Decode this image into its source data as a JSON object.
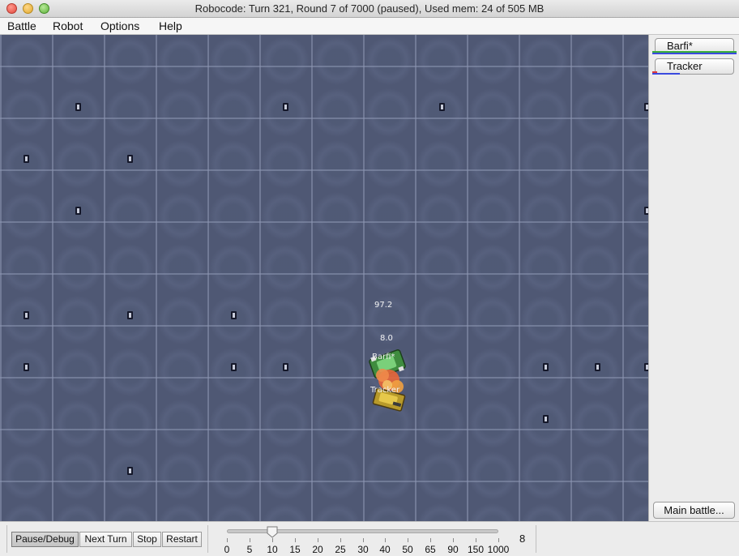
{
  "window": {
    "title": "Robocode: Turn 321, Round 7 of 7000 (paused), Used mem: 24 of 505 MB"
  },
  "menu": {
    "items": [
      "Battle",
      "Robot",
      "Options",
      "Help"
    ]
  },
  "battlefield": {
    "robots": [
      {
        "name": "Barfi*",
        "energy": "97.2",
        "bullet_power": "8.0"
      },
      {
        "name": "Tracker"
      }
    ]
  },
  "robot_panel": {
    "buttons": [
      {
        "label": "Barfi*",
        "energy_color": "#3aaf3a",
        "secondary_color": "#3a4adf"
      },
      {
        "label": "Tracker",
        "energy_color": "#df3a3a",
        "secondary_color": "#3a4adf"
      }
    ],
    "main_battle_label": "Main battle..."
  },
  "controls": {
    "pause_label": "Pause/Debug",
    "next_turn_label": "Next Turn",
    "stop_label": "Stop",
    "restart_label": "Restart",
    "speed_ticks": [
      "0",
      "5",
      "10",
      "15",
      "20",
      "25",
      "30",
      "40",
      "50",
      "65",
      "90",
      "150",
      "1000"
    ],
    "speed_selected_index": 2,
    "speed_value": "8"
  },
  "icons": {
    "close": "close-traffic-light-icon",
    "minimize": "minimize-traffic-light-icon",
    "maximize": "zoom-traffic-light-icon",
    "slider_thumb": "slider-thumb-icon"
  }
}
